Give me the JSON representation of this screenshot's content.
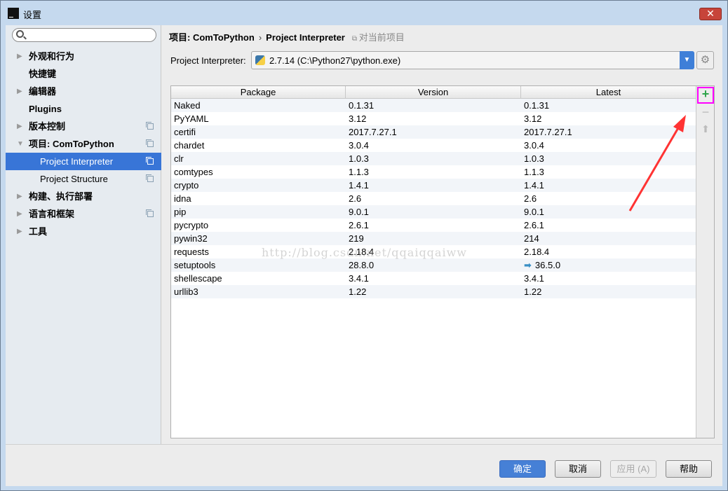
{
  "window": {
    "title": "设置",
    "close": "✕",
    "app_icon": "PC"
  },
  "search": {
    "placeholder": ""
  },
  "sidebar": {
    "items": [
      {
        "label": "外观和行为",
        "arrow": "▶",
        "copy": false
      },
      {
        "label": "快捷键",
        "arrow": "",
        "copy": false
      },
      {
        "label": "编辑器",
        "arrow": "▶",
        "copy": false
      },
      {
        "label": "Plugins",
        "arrow": "",
        "copy": false
      },
      {
        "label": "版本控制",
        "arrow": "▶",
        "copy": true
      },
      {
        "label": "项目: ComToPython",
        "arrow": "▼",
        "copy": true
      },
      {
        "label": "Project Interpreter",
        "arrow": "",
        "copy": true,
        "sub": true,
        "selected": true
      },
      {
        "label": "Project Structure",
        "arrow": "",
        "copy": true,
        "sub": true
      },
      {
        "label": "构建、执行部署",
        "arrow": "▶",
        "copy": false
      },
      {
        "label": "语言和框架",
        "arrow": "▶",
        "copy": true
      },
      {
        "label": "工具",
        "arrow": "▶",
        "copy": false
      }
    ]
  },
  "breadcrumb": {
    "project": "项目: ComToPython",
    "sep": "›",
    "page": "Project Interpreter",
    "scope": "对当前项目"
  },
  "interpreter": {
    "label": "Project Interpreter:",
    "value": "2.7.14 (C:\\Python27\\python.exe)"
  },
  "table": {
    "columns": [
      "Package",
      "Version",
      "Latest"
    ],
    "rows": [
      [
        "Naked",
        "0.1.31",
        "0.1.31"
      ],
      [
        "PyYAML",
        "3.12",
        "3.12"
      ],
      [
        "certifi",
        "2017.7.27.1",
        "2017.7.27.1"
      ],
      [
        "chardet",
        "3.0.4",
        "3.0.4"
      ],
      [
        "clr",
        "1.0.3",
        "1.0.3"
      ],
      [
        "comtypes",
        "1.1.3",
        "1.1.3"
      ],
      [
        "crypto",
        "1.4.1",
        "1.4.1"
      ],
      [
        "idna",
        "2.6",
        "2.6"
      ],
      [
        "pip",
        "9.0.1",
        "9.0.1"
      ],
      [
        "pycrypto",
        "2.6.1",
        "2.6.1"
      ],
      [
        "pywin32",
        "219",
        "214"
      ],
      [
        "requests",
        "2.18.4",
        "2.18.4"
      ],
      [
        "setuptools",
        "28.8.0",
        "36.5.0"
      ],
      [
        "shellescape",
        "3.4.1",
        "3.4.1"
      ],
      [
        "urllib3",
        "1.22",
        "1.22"
      ]
    ],
    "upgrade_rows": [
      12
    ]
  },
  "tools": {
    "add": "+",
    "remove": "−",
    "upgrade": "⬆"
  },
  "watermark": "http://blog.csdn.net/qqaiqqaiww",
  "footer": {
    "ok": "确定",
    "cancel": "取消",
    "apply": "应用 (A)",
    "help": "帮助"
  },
  "colors": {
    "accent": "#3875d7",
    "add": "#2ea44a",
    "highlight": "#ff00ff",
    "arrow": "#ff3333"
  }
}
